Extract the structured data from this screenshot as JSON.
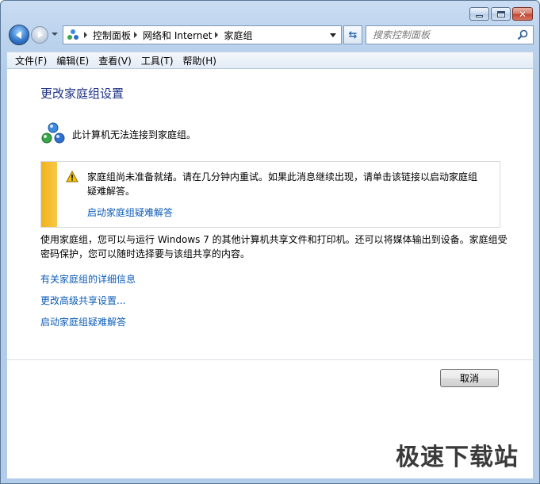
{
  "nav": {
    "breadcrumbs": [
      "控制面板",
      "网络和 Internet",
      "家庭组"
    ],
    "search_placeholder": "搜索控制面板"
  },
  "menubar": {
    "items": [
      "文件(F)",
      "编辑(E)",
      "查看(V)",
      "工具(T)",
      "帮助(H)"
    ]
  },
  "main": {
    "title": "更改家庭组设置",
    "status": "此计算机无法连接到家庭组。",
    "warning": {
      "text": "家庭组尚未准备就绪。请在几分钟内重试。如果此消息继续出现，请单击该链接以启动家庭组疑难解答。",
      "link": "启动家庭组疑难解答"
    },
    "description": "使用家庭组，您可以与运行 Windows 7 的其他计算机共享文件和打印机。还可以将媒体输出到设备。家庭组受密码保护，您可以随时选择要与该组共享的内容。",
    "links": [
      "有关家庭组的详细信息",
      "更改高级共享设置...",
      "启动家庭组疑难解答"
    ]
  },
  "footer": {
    "cancel_label": "取消",
    "watermark": "极速下载站"
  },
  "colors": {
    "link": "#0e5cb8",
    "title": "#1e3287",
    "warning_stripe": "#f2b21a"
  },
  "icons": [
    "back-arrow-icon",
    "forward-arrow-icon",
    "homegroup-icon",
    "refresh-icon",
    "search-icon",
    "warning-icon",
    "minimize-icon",
    "maximize-icon",
    "close-icon"
  ]
}
